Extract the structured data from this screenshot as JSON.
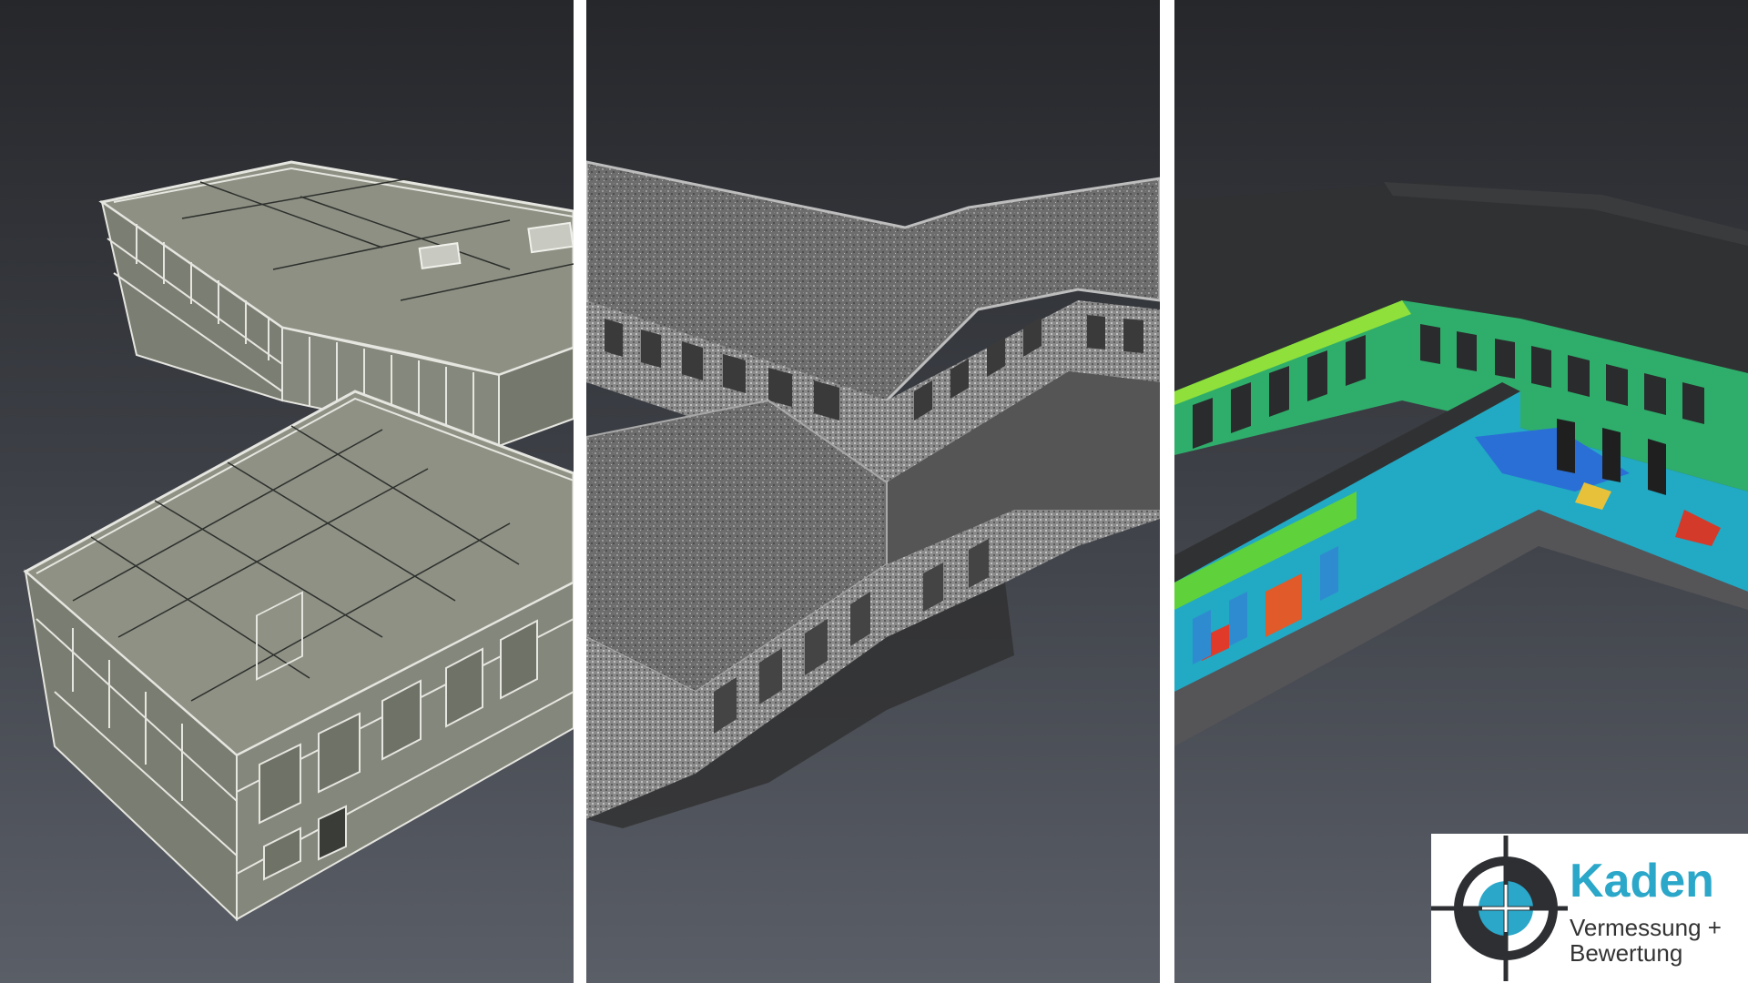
{
  "panels": [
    {
      "label": "cad-wireframe-model"
    },
    {
      "label": "point-cloud-scan"
    },
    {
      "label": "deviation-heatmap"
    }
  ],
  "logo": {
    "brand": "Kaden",
    "tagline_line1": "Vermessung +",
    "tagline_line2": "Bewertung",
    "brand_color": "#2aa7c9",
    "text_color": "#333333",
    "mark_icon": "crosshair-target-icon"
  },
  "colors": {
    "background_top": "#26272b",
    "background_bottom": "#5a5e67",
    "model_face": "#8e9184",
    "divider": "#ffffff"
  }
}
